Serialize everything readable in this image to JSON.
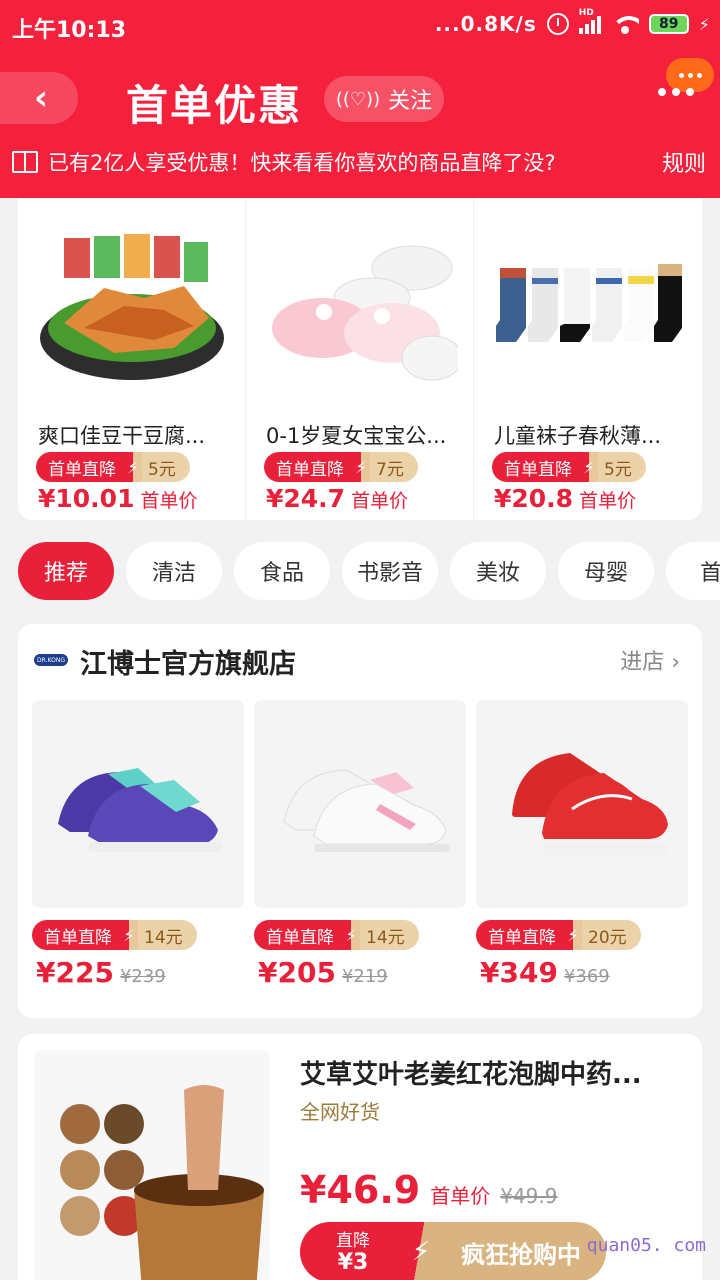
{
  "status_bar": {
    "time": "上午10:13",
    "net_speed": "...0.8K/s",
    "hd": "HD",
    "battery": "89"
  },
  "header": {
    "back_icon": "chevron-left-icon",
    "title": "首单优惠",
    "follow_label": "关注",
    "promo_text": "已有2亿人享受优惠！快来看看你喜欢的商品直降了没?",
    "rules_label": "规则",
    "colors": {
      "header_bg": "#f5203c",
      "accent": "#e8203a",
      "gold": "#ecd2a8"
    }
  },
  "top_products": [
    {
      "name": "爽口佳豆干豆腐...",
      "badge_label": "首单直降",
      "discount": "5元",
      "price": "¥10.01",
      "price_tag": "首单价"
    },
    {
      "name": "0-1岁夏女宝宝公...",
      "badge_label": "首单直降",
      "discount": "7元",
      "price": "¥24.7",
      "price_tag": "首单价"
    },
    {
      "name": "儿童袜子春秋薄...",
      "badge_label": "首单直降",
      "discount": "5元",
      "price": "¥20.8",
      "price_tag": "首单价"
    }
  ],
  "categories": [
    {
      "label": "推荐",
      "active": true
    },
    {
      "label": "清洁"
    },
    {
      "label": "食品"
    },
    {
      "label": "书影音"
    },
    {
      "label": "美妆"
    },
    {
      "label": "母婴"
    },
    {
      "label": "首饰"
    }
  ],
  "store": {
    "logo_text": "DR.KONG",
    "name": "江博士官方旗舰店",
    "enter_label": "进店 ›",
    "products": [
      {
        "badge_label": "首单直降",
        "discount": "14元",
        "price": "¥225",
        "old_price": "¥239"
      },
      {
        "badge_label": "首单直降",
        "discount": "14元",
        "price": "¥205",
        "old_price": "¥219"
      },
      {
        "badge_label": "首单直降",
        "discount": "20元",
        "price": "¥349",
        "old_price": "¥369"
      }
    ]
  },
  "featured": {
    "title": "艾草艾叶老姜红花泡脚中药...",
    "subtitle": "全网好货",
    "price": "¥46.9",
    "price_tag": "首单价",
    "old_price": "¥49.9",
    "cut_label": "直降",
    "cut_value": "¥3",
    "buy_label": "疯狂抢购中"
  },
  "watermark": "quan05. com"
}
